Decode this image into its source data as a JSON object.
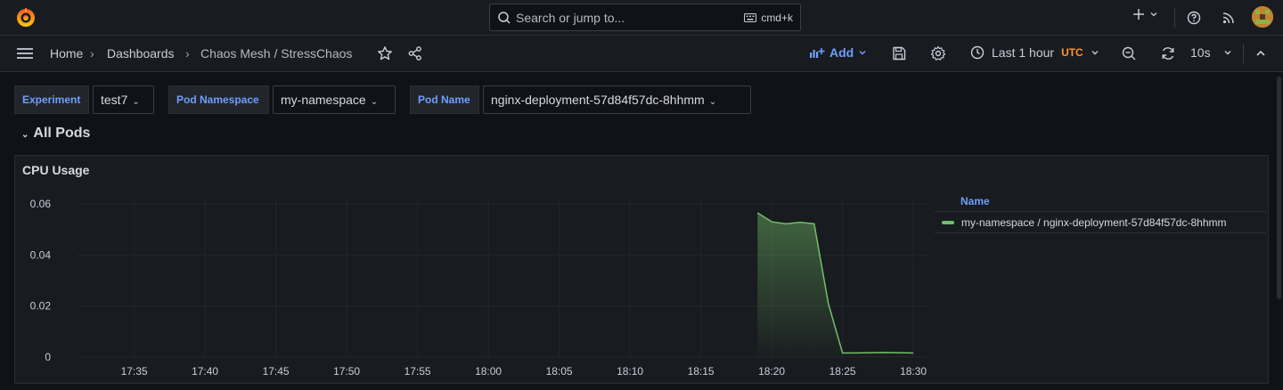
{
  "topbar": {
    "search_placeholder": "Search or jump to...",
    "search_shortcut": "cmd+k",
    "icons": [
      "grafana-logo-icon",
      "search-icon",
      "keyboard-icon",
      "plus-icon",
      "help-icon",
      "rss-icon",
      "avatar"
    ]
  },
  "navbar": {
    "breadcrumbs": [
      "Home",
      "Dashboards",
      "Chaos Mesh / StressChaos"
    ],
    "add_label": "Add",
    "time_range": "Last 1 hour",
    "timezone": "UTC",
    "refresh_interval": "10s"
  },
  "variables": [
    {
      "label": "Experiment",
      "value": "test7"
    },
    {
      "label": "Pod Namespace",
      "value": "my-namespace"
    },
    {
      "label": "Pod Name",
      "value": "nginx-deployment-57d84f57dc-8hhmm"
    }
  ],
  "row": {
    "title": "All Pods"
  },
  "panel": {
    "title": "CPU Usage",
    "legend_header": "Name",
    "legend_series": "my-namespace / nginx-deployment-57d84f57dc-8hhmm"
  },
  "colors": {
    "series": "#73bf69",
    "accent": "#6e9fff",
    "utc": "#ff9830"
  },
  "chart_data": {
    "type": "area",
    "title": "CPU Usage",
    "xlabel": "",
    "ylabel": "",
    "x_ticks": [
      "17:35",
      "17:40",
      "17:45",
      "17:50",
      "17:55",
      "18:00",
      "18:05",
      "18:10",
      "18:15",
      "18:20",
      "18:25",
      "18:30"
    ],
    "y_ticks": [
      "0",
      "0.02",
      "0.04",
      "0.06"
    ],
    "ylim": [
      0,
      0.06
    ],
    "xlim": [
      "17:31",
      "18:31"
    ],
    "grid": true,
    "legend_position": "right",
    "series": [
      {
        "name": "my-namespace / nginx-deployment-57d84f57dc-8hhmm",
        "x": [
          "18:19",
          "18:20",
          "18:21",
          "18:22",
          "18:23",
          "18:24",
          "18:25",
          "18:26",
          "18:27",
          "18:28",
          "18:29",
          "18:30"
        ],
        "y": [
          0.0565,
          0.053,
          0.0522,
          0.0528,
          0.0522,
          0.021,
          0.0016,
          0.0016,
          0.0017,
          0.0018,
          0.0017,
          0.0016
        ]
      }
    ]
  }
}
